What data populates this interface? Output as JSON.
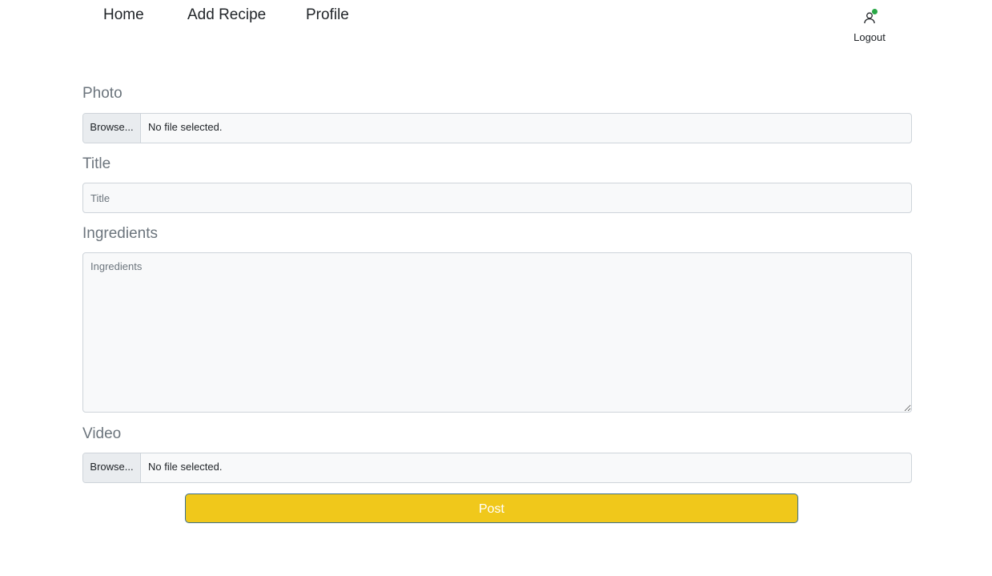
{
  "nav": {
    "items": [
      {
        "label": "Home"
      },
      {
        "label": "Add Recipe"
      },
      {
        "label": "Profile"
      }
    ],
    "user": {
      "icon": "user-icon",
      "status_color": "#28a745",
      "logout_label": "Logout"
    }
  },
  "form": {
    "photo": {
      "label": "Photo",
      "browse_label": "Browse...",
      "file_status": "No file selected."
    },
    "title": {
      "label": "Title",
      "placeholder": "Title",
      "value": ""
    },
    "ingredients": {
      "label": "Ingredients",
      "placeholder": "Ingredients",
      "value": ""
    },
    "video": {
      "label": "Video",
      "browse_label": "Browse...",
      "file_status": "No file selected."
    },
    "post_label": "Post"
  },
  "colors": {
    "post_button": "#f0c81b",
    "post_border": "#3b6f8f",
    "label_text": "#6c757d",
    "input_bg": "#f8f9fa"
  }
}
